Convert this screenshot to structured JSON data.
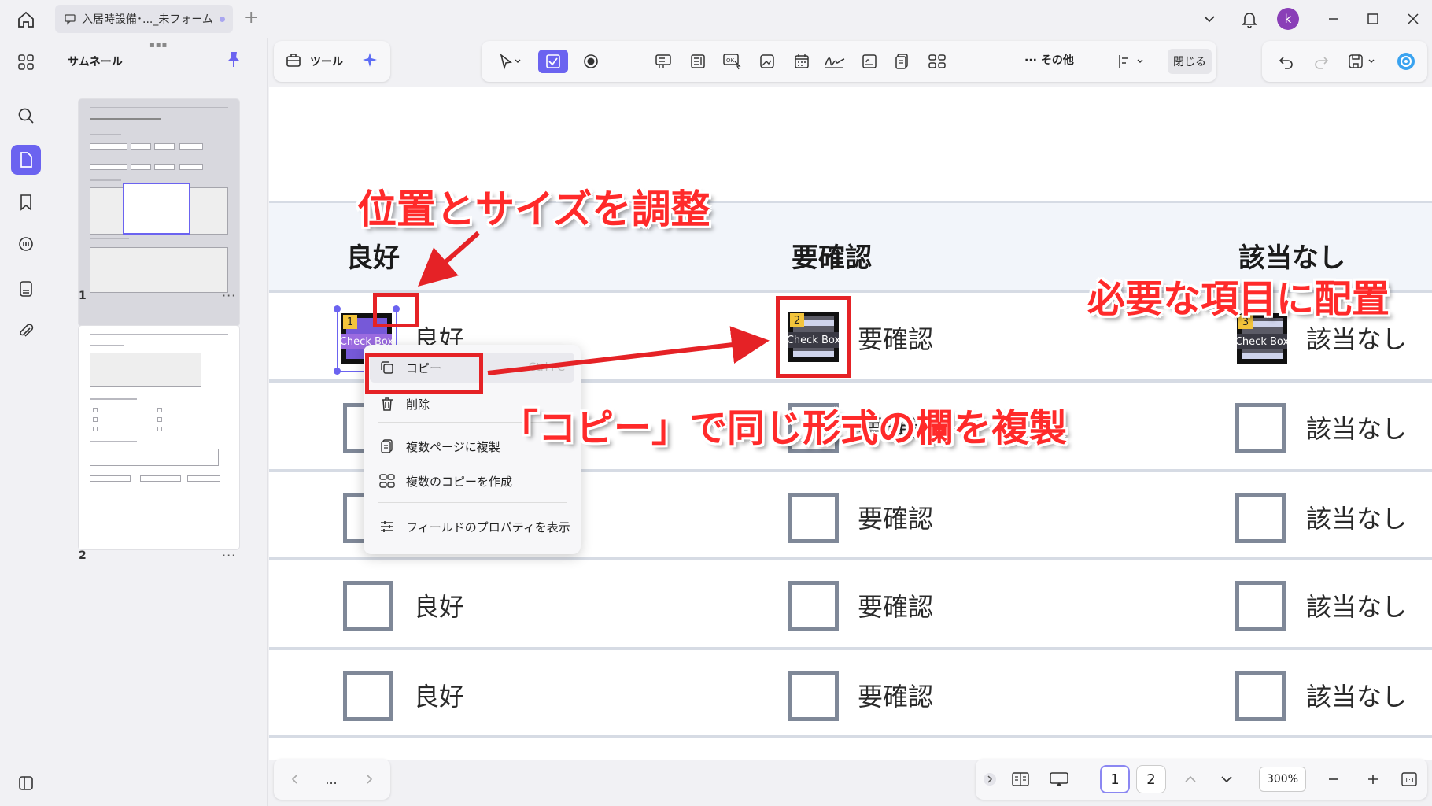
{
  "tab": {
    "title": "入居時設備･..._未フォーム"
  },
  "user": {
    "avatar_letter": "k"
  },
  "sidebar": {
    "panel_title": "サムネール",
    "pages": [
      {
        "number": "1"
      },
      {
        "number": "2"
      }
    ]
  },
  "toolbar": {
    "tools_label": "ツール",
    "more_label": "その他",
    "close_label": "閉じる"
  },
  "document": {
    "columns": [
      "良好",
      "要確認",
      "該当なし"
    ],
    "field_label": "Check Box",
    "field_numbers": [
      "1",
      "2",
      "3"
    ],
    "row_labels": {
      "good": "良好",
      "check": "要確認",
      "na": "該当なし"
    }
  },
  "context_menu": {
    "items": [
      {
        "label": "コピー",
        "shortcut": "Ctrl+C"
      },
      {
        "label": "削除"
      },
      {
        "label": "複数ページに複製"
      },
      {
        "label": "複数のコピーを作成"
      },
      {
        "label": "フィールドのプロパティを表示"
      }
    ]
  },
  "annotations": {
    "resize": "位置とサイズを調整",
    "place": "必要な項目に配置",
    "copy": "「コピー」で同じ形式の欄を複製"
  },
  "bottom": {
    "pages": [
      "1",
      "2"
    ],
    "zoom": "300%",
    "more": "..."
  },
  "colors": {
    "accent": "#6b63f0",
    "annotation_red": "#e52226"
  }
}
